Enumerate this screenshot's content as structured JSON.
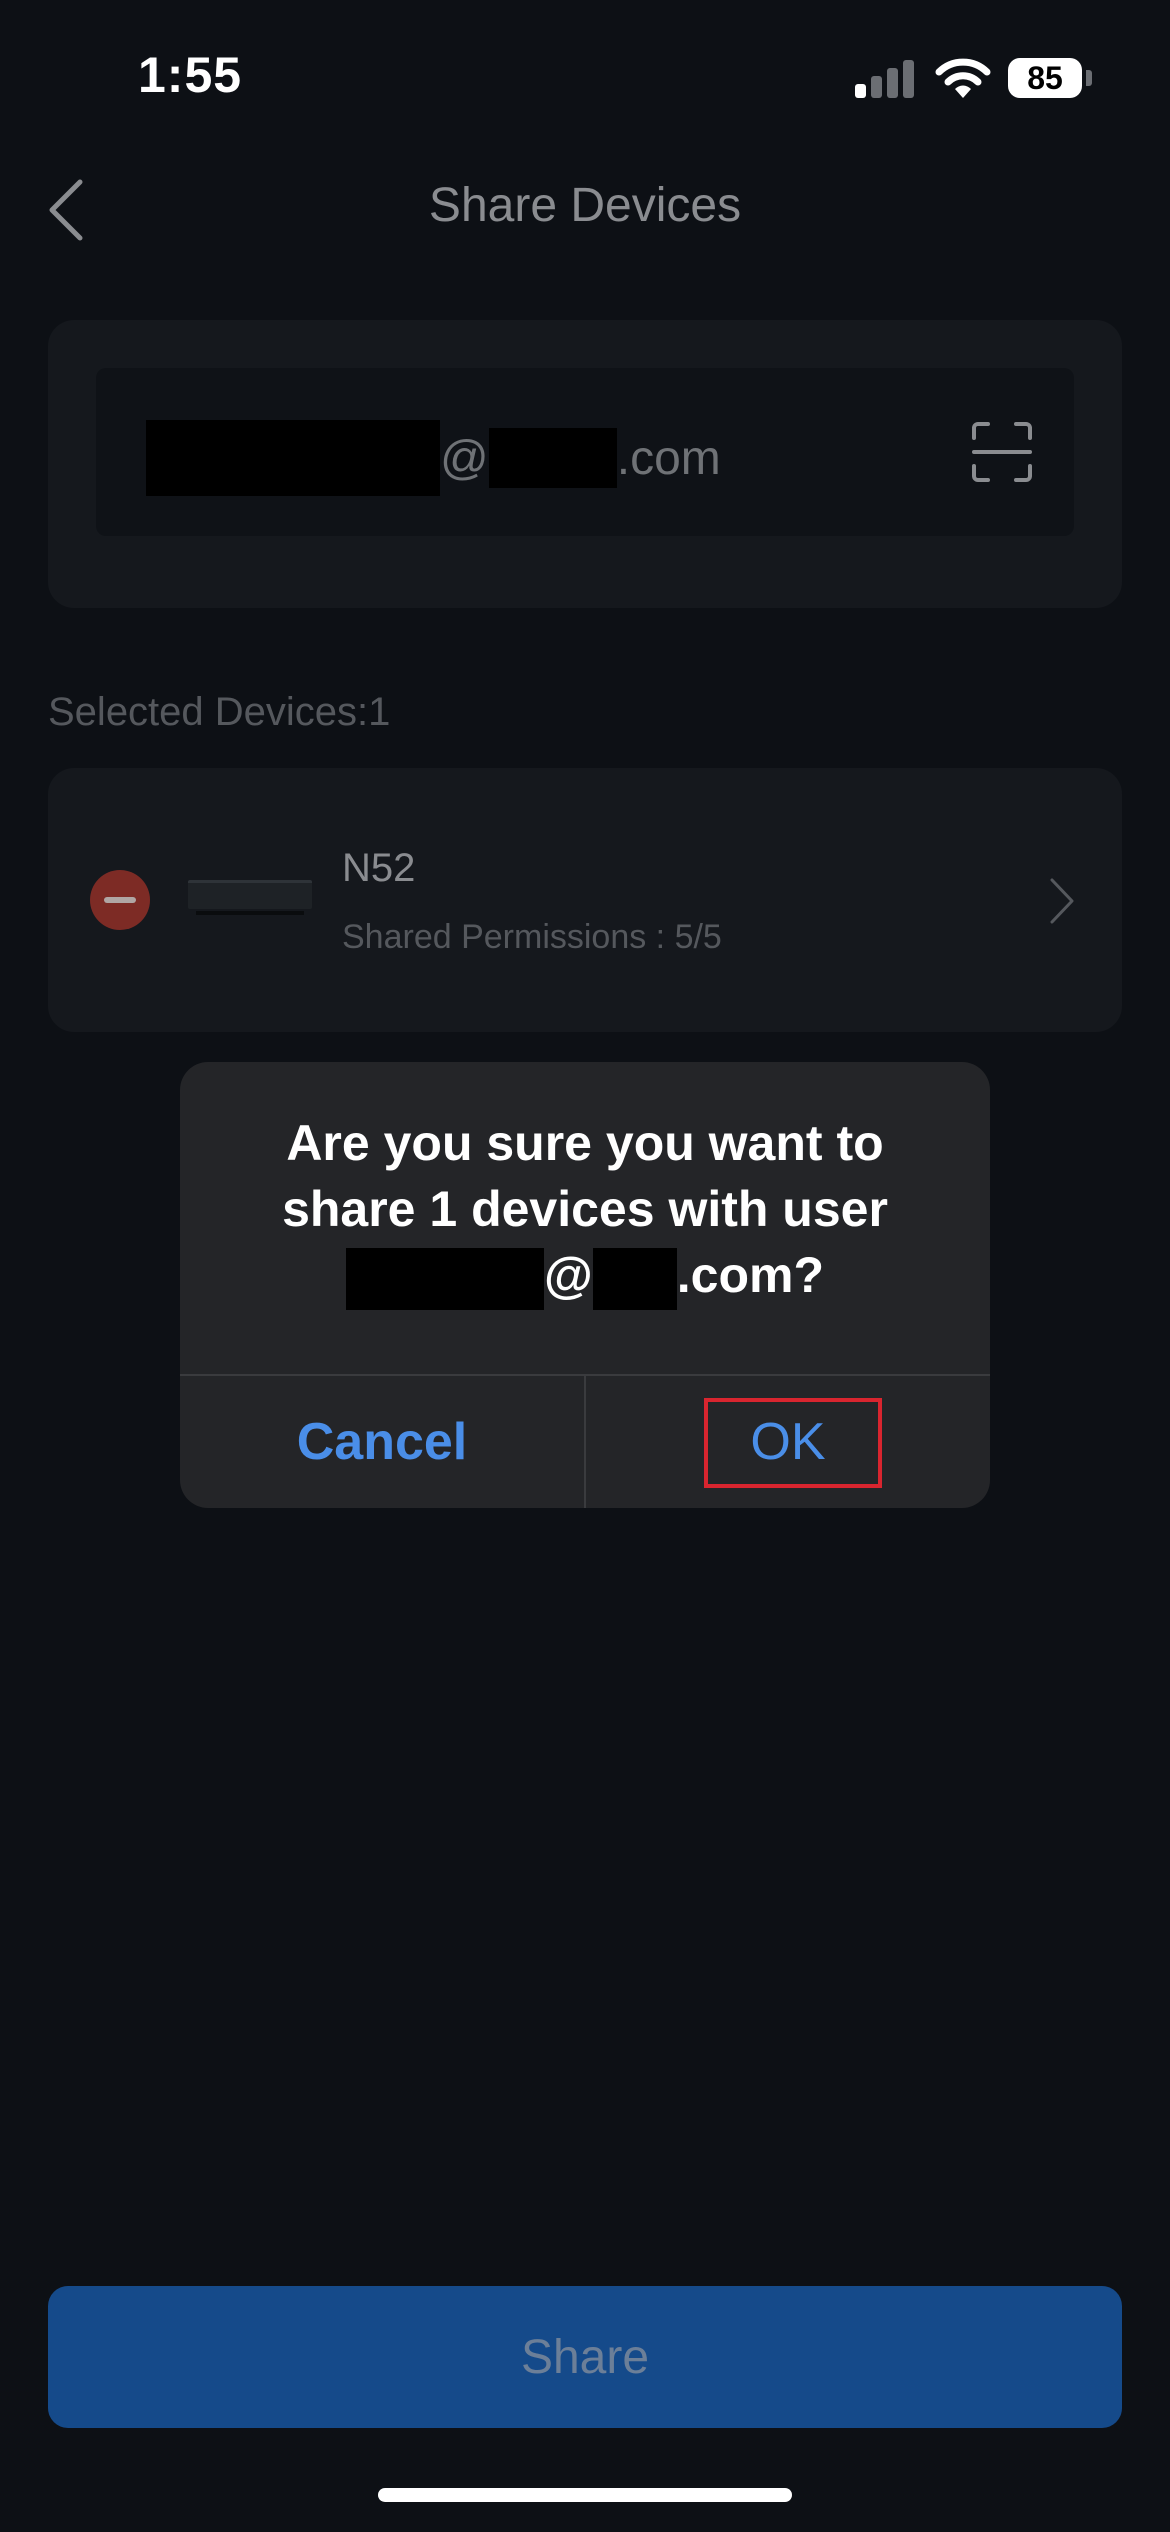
{
  "status_bar": {
    "time": "1:55",
    "battery": "85"
  },
  "nav": {
    "title": "Share Devices"
  },
  "email": {
    "at": "@",
    "domain_suffix": ".com"
  },
  "selected": {
    "label": "Selected Devices:1"
  },
  "device": {
    "name": "N52",
    "permissions": "Shared Permissions : 5/5"
  },
  "dialog": {
    "line1": "Are you sure you want to",
    "line2": "share 1 devices with user",
    "at": "@",
    "suffix": ".com?",
    "cancel_label": "Cancel",
    "ok_label": "OK"
  },
  "share": {
    "label": "Share"
  },
  "colors": {
    "accent": "#4a8ee8",
    "share_button": "#154a8a",
    "highlight": "#d9252f"
  },
  "icons": [
    "back-chevron-icon",
    "scan-icon",
    "remove-icon",
    "chevron-right-icon",
    "wifi-icon",
    "signal-icon",
    "battery-icon"
  ]
}
